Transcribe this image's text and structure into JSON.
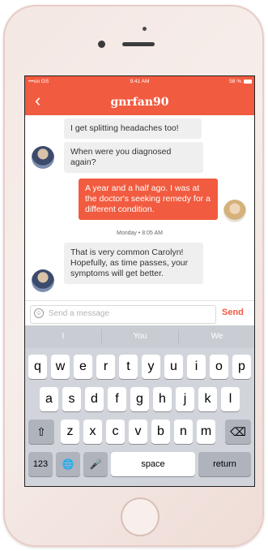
{
  "status_bar": {
    "carrier": "•••oo GS",
    "time": "9:41 AM",
    "battery": "58 %"
  },
  "nav": {
    "back_icon": "chevron-left-icon",
    "title": "gnrfan90"
  },
  "messages": [
    {
      "side": "in",
      "text": "I get splitting headaches too!"
    },
    {
      "side": "in",
      "text": "When were you diagnosed again?"
    },
    {
      "side": "out",
      "text": "A year and a half ago. I was at the doctor's seeking remedy for a different condition."
    },
    {
      "side": "in",
      "text": "That is very common Carolyn! Hopefully, as time passes, your symptoms will get better."
    }
  ],
  "timestamp": "Monday  •  8:05 AM",
  "composer": {
    "placeholder": "Send a message",
    "send_label": "Send"
  },
  "keyboard": {
    "suggestions": [
      "I",
      "You",
      "We"
    ],
    "row1": [
      "q",
      "w",
      "e",
      "r",
      "t",
      "y",
      "u",
      "i",
      "o",
      "p"
    ],
    "row2": [
      "a",
      "s",
      "d",
      "f",
      "g",
      "h",
      "j",
      "k",
      "l"
    ],
    "row3": [
      "z",
      "x",
      "c",
      "v",
      "b",
      "n",
      "m"
    ],
    "shift_icon": "⇧",
    "delete_icon": "⌫",
    "numbers_label": "123",
    "globe_icon": "🌐",
    "mic_icon": "🎤",
    "space_label": "space",
    "return_label": "return"
  },
  "colors": {
    "accent": "#f15b3f",
    "bubble_in": "#efefef"
  }
}
